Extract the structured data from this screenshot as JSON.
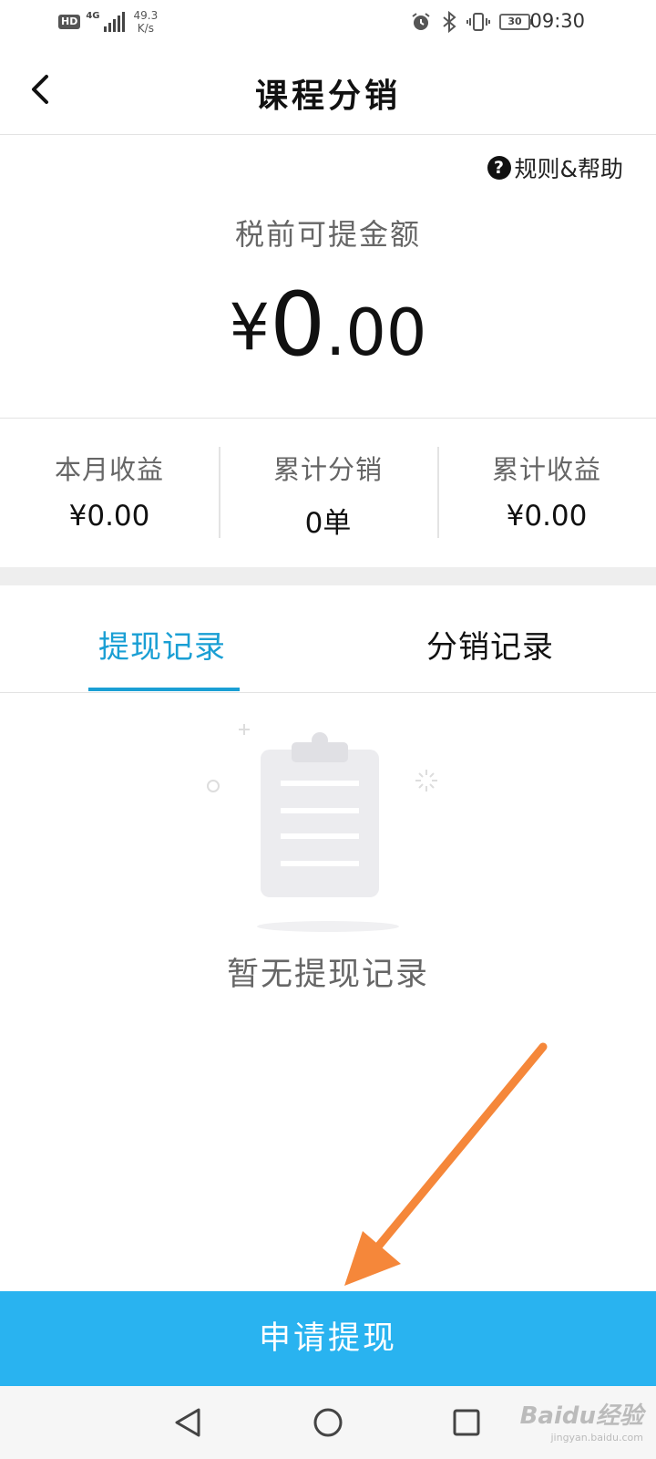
{
  "status_bar": {
    "hd": "HD",
    "network": "4G",
    "speed_value": "49.3",
    "speed_unit": "K/s",
    "battery": "30",
    "time": "09:30"
  },
  "header": {
    "title": "课程分销",
    "back_icon": "chevron-left-icon"
  },
  "help": {
    "label": "规则&帮助",
    "icon": "question-circle-icon",
    "icon_glyph": "?"
  },
  "balance": {
    "label": "税前可提金额",
    "currency": "¥",
    "integer": "0",
    "decimal": ".00"
  },
  "stats": [
    {
      "label": "本月收益",
      "value": "¥0.00"
    },
    {
      "label": "累计分销",
      "value": "0单"
    },
    {
      "label": "累计收益",
      "value": "¥0.00"
    }
  ],
  "tabs": {
    "items": [
      {
        "label": "提现记录",
        "active": true
      },
      {
        "label": "分销记录",
        "active": false
      }
    ]
  },
  "empty_state": {
    "icon": "clipboard-icon",
    "text": "暂无提现记录"
  },
  "primary_button": {
    "label": "申请提现"
  },
  "nav_bar": {
    "back_icon": "triangle-back-icon",
    "home_icon": "circle-home-icon",
    "recent_icon": "square-recent-icon"
  },
  "watermark": {
    "text": "Baidu经验",
    "sub": "jingyan.baidu.com"
  },
  "colors": {
    "accent": "#1a9fd4",
    "button": "#29b3f0",
    "arrow": "#f5873a",
    "divider": "#e3e3e3"
  }
}
